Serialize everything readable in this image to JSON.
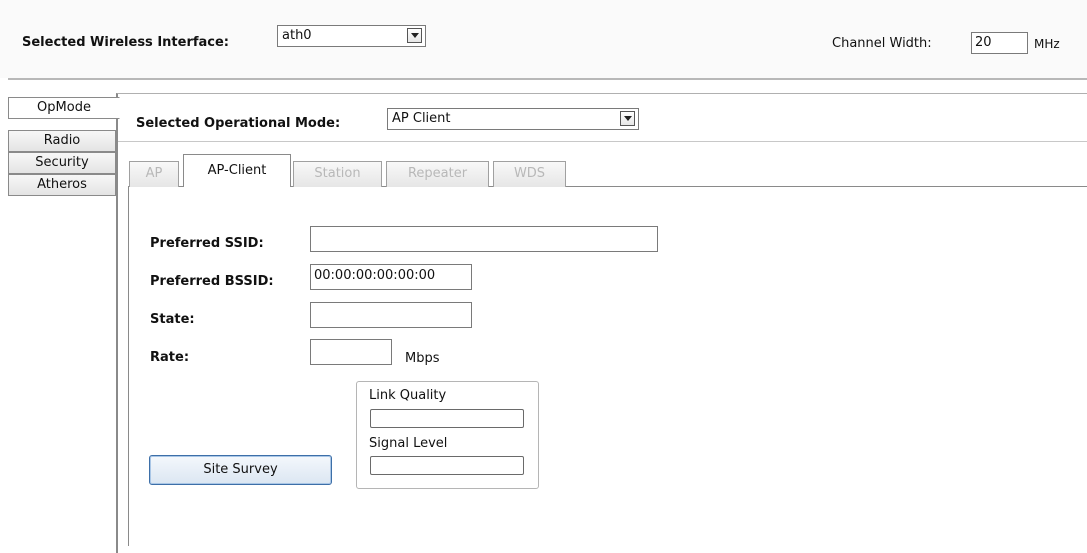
{
  "header": {
    "interface_label": "Selected Wireless Interface:",
    "interface_value": "ath0",
    "channel_width_label": "Channel Width:",
    "channel_width_value": "20",
    "channel_width_unit": "MHz"
  },
  "side_tabs": [
    {
      "label": "OpMode",
      "active": true
    },
    {
      "label": "Radio"
    },
    {
      "label": "Security"
    },
    {
      "label": "Atheros"
    }
  ],
  "opmode": {
    "label": "Selected Operational Mode:",
    "value": "AP Client"
  },
  "mode_tabs": [
    {
      "label": "AP",
      "enabled": false
    },
    {
      "label": "AP-Client",
      "enabled": true,
      "active": true
    },
    {
      "label": "Station",
      "enabled": false
    },
    {
      "label": "Repeater",
      "enabled": false
    },
    {
      "label": "WDS",
      "enabled": false
    }
  ],
  "form": {
    "ssid_label": "Preferred SSID:",
    "ssid_value": "",
    "bssid_label": "Preferred BSSID:",
    "bssid_value": "00:00:00:00:00:00",
    "state_label": "State:",
    "state_value": "",
    "rate_label": "Rate:",
    "rate_value": "",
    "rate_unit": "Mbps"
  },
  "quality": {
    "link_quality_label": "Link Quality",
    "link_quality_fraction": 0,
    "signal_level_label": "Signal Level",
    "signal_level_fraction": 0
  },
  "site_survey_label": "Site Survey",
  "colors": {
    "button_border": "#3d6fa8",
    "disabled_tab_text": "#b8b8b8"
  },
  "icons": {
    "dropdown": "chevron-down-icon"
  }
}
